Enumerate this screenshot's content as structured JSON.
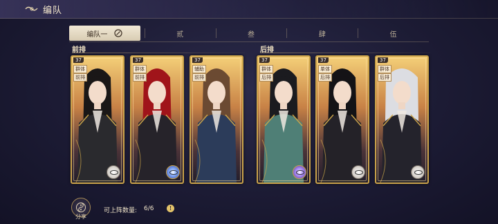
{
  "header": {
    "title": "编队"
  },
  "tabs": [
    {
      "label": "编队一",
      "active": true
    },
    {
      "label": "贰"
    },
    {
      "label": "叁"
    },
    {
      "label": "肆"
    },
    {
      "label": "伍"
    }
  ],
  "front_row": {
    "label": "前排"
  },
  "back_row": {
    "label": "后排"
  },
  "cards": [
    {
      "level": "37",
      "tag1": "群体",
      "tag2": "前排",
      "badge": "silver-eye",
      "hair": "#1a1717",
      "robe": "#2a2a2e"
    },
    {
      "level": "37",
      "tag1": "群体",
      "tag2": "前排",
      "badge": "blue-eye",
      "hair": "#a0141a",
      "robe": "#26232a"
    },
    {
      "level": "37",
      "tag1": "辅助",
      "tag2": "前排",
      "badge": "none",
      "hair": "#6b4a32",
      "robe": "#2c3c5a"
    },
    {
      "level": "37",
      "tag1": "群体",
      "tag2": "后排",
      "badge": "purple-eye",
      "hair": "#1b1b1f",
      "robe": "#4f7f76"
    },
    {
      "level": "37",
      "tag1": "单体",
      "tag2": "后排",
      "badge": "silver-eye",
      "hair": "#141316",
      "robe": "#242228"
    },
    {
      "level": "37",
      "tag1": "群体",
      "tag2": "后排",
      "badge": "silver-eye",
      "hair": "#dcdde2",
      "robe": "#24232c"
    }
  ],
  "footer": {
    "share_label": "分享",
    "count_label": "可上阵数量:",
    "count_value": "6/6"
  }
}
